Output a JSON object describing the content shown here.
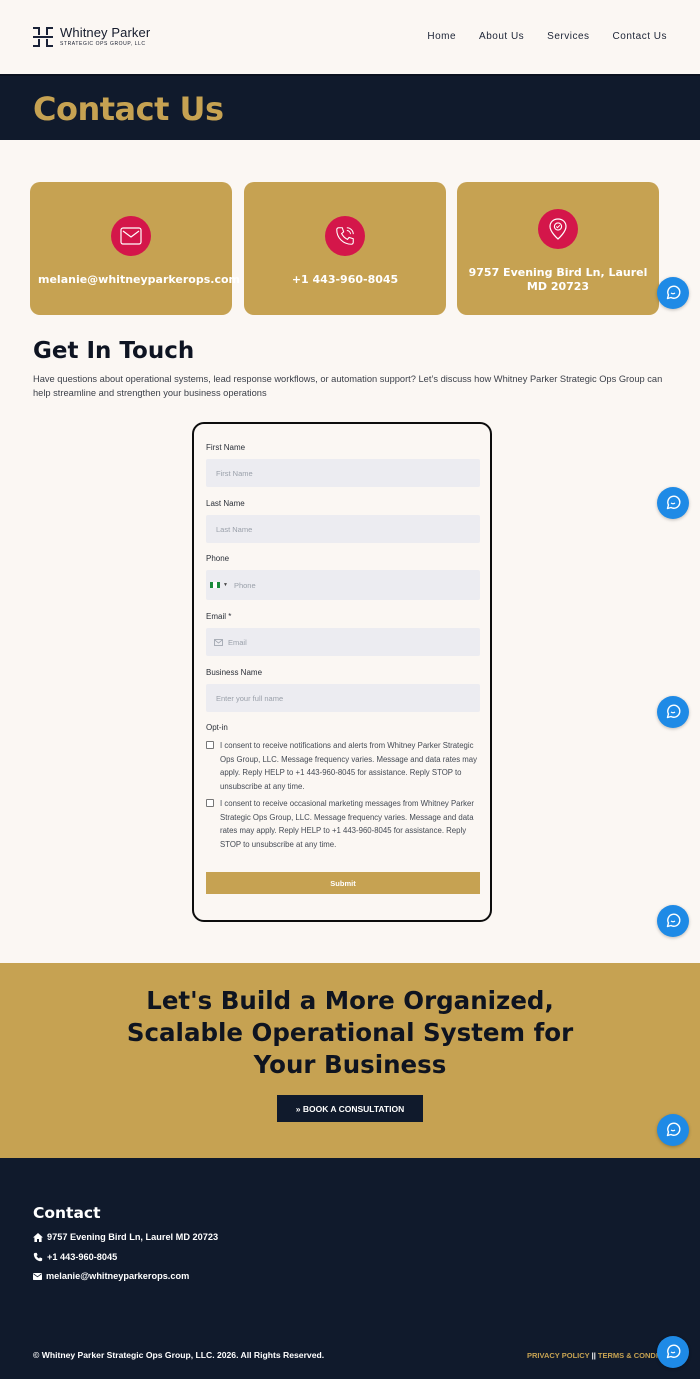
{
  "brand": {
    "name": "Whitney Parker",
    "subtitle": "STRATEGIC OPS GROUP, LLC"
  },
  "nav": {
    "items": [
      "Home",
      "About Us",
      "Services",
      "Contact Us"
    ]
  },
  "hero": {
    "title": "Contact Us"
  },
  "cards": {
    "email": "melanie@whitneyparkerops.com",
    "phone": "+1 443-960-8045",
    "address": "9757 Evening Bird Ln, Laurel MD 20723"
  },
  "get_in_touch": {
    "title": "Get In Touch",
    "description": "Have questions about operational systems, lead response workflows, or automation support? Let’s discuss how Whitney Parker Strategic Ops Group can help streamline and strengthen your business operations"
  },
  "form": {
    "first_name_label": "First Name",
    "first_name_placeholder": "First Name",
    "last_name_label": "Last Name",
    "last_name_placeholder": "Last Name",
    "phone_label": "Phone",
    "phone_placeholder": "Phone",
    "email_label": "Email *",
    "email_placeholder": "Email",
    "business_label": "Business Name",
    "business_placeholder": "Enter your full name",
    "optin_label": "Opt-in",
    "consent_1": "I consent to receive notifications and alerts from Whitney Parker Strategic Ops Group, LLC. Message frequency varies. Message and data rates may apply. Reply HELP to +1 443-960-8045 for assistance. Reply STOP to unsubscribe at any time.",
    "consent_2": "I consent to receive occasional marketing messages from Whitney Parker Strategic Ops Group, LLC. Message frequency varies. Message and data rates may apply. Reply HELP to +1 443-960-8045 for assistance. Reply STOP to unsubscribe at any time.",
    "submit_label": "Submit"
  },
  "cta": {
    "title": "Let's Build a More Organized, Scalable Operational System for Your Business",
    "button_label": "» BOOK A CONSULTATION"
  },
  "footer": {
    "contact_title": "Contact",
    "address": "9757 Evening Bird Ln, Laurel MD 20723",
    "phone": "+1 443-960-8045",
    "email": "melanie@whitneyparkerops.com",
    "copyright": "© Whitney Parker Strategic Ops Group, LLC. 2026. All Rights Reserved.",
    "privacy_label": "PRIVACY POLICY",
    "separator": " || ",
    "terms_label": "TERMS & CONDITIONS"
  },
  "colors": {
    "gold": "#c6a252",
    "navy": "#101a2c",
    "crimson": "#d4164a",
    "chat_blue": "#1e8ae6",
    "cream": "#fbf7f3"
  },
  "icons": [
    "logo-mark-icon",
    "envelope-icon",
    "phone-icon",
    "location-pin-icon",
    "flag-icon",
    "home-icon",
    "chat-bubble-icon"
  ]
}
